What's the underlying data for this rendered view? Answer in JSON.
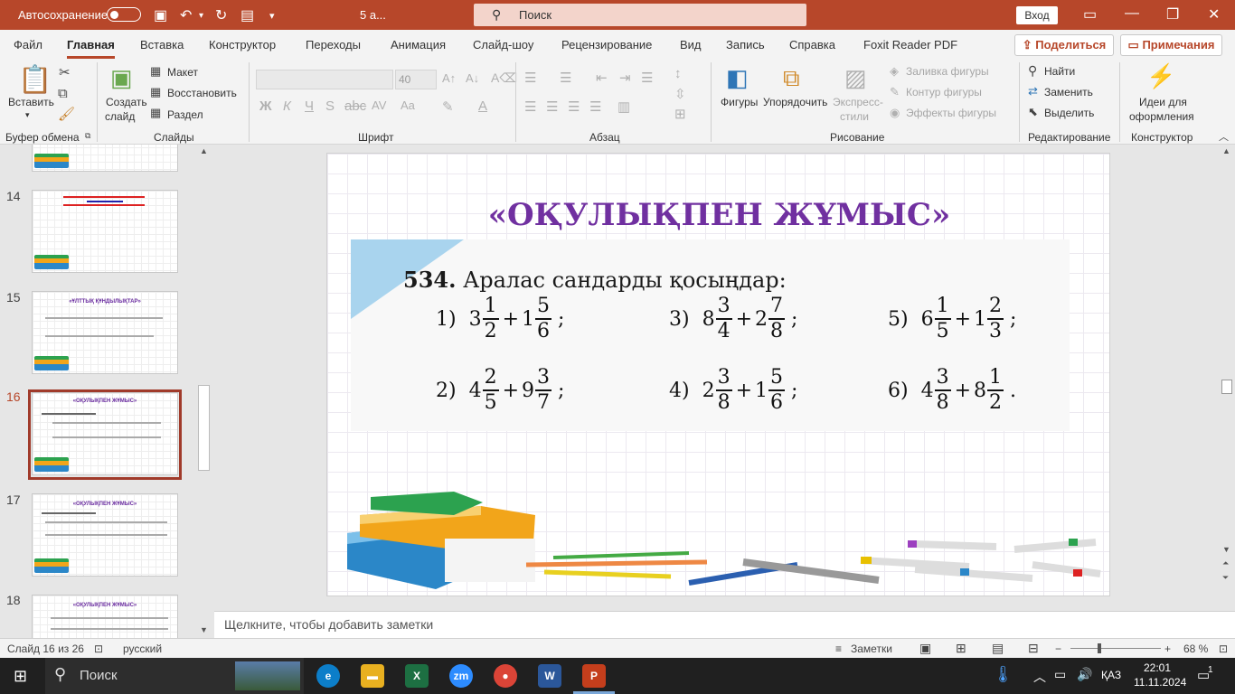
{
  "titlebar": {
    "autosave_label": "Автосохранение",
    "filename": "5 а...",
    "search_placeholder": "Поиск",
    "signin_label": "Вход"
  },
  "menu": {
    "items": [
      "Файл",
      "Главная",
      "Вставка",
      "Конструктор",
      "Переходы",
      "Анимация",
      "Слайд-шоу",
      "Рецензирование",
      "Вид",
      "Запись",
      "Справка",
      "Foxit Reader PDF"
    ],
    "share_label": "Поделиться",
    "comments_label": "Примечания"
  },
  "ribbon": {
    "paste_label": "Вставить",
    "clipboard_group": "Буфер обмена",
    "new_slide_label_1": "Создать",
    "new_slide_label_2": "слайд",
    "layout_label": "Макет",
    "reset_label": "Восстановить",
    "section_label": "Раздел",
    "slides_group": "Слайды",
    "font_size": "40",
    "font_group": "Шрифт",
    "paragraph_group": "Абзац",
    "shapes_label": "Фигуры",
    "arrange_label": "Упорядочить",
    "quick_styles_1": "Экспресс-",
    "quick_styles_2": "стили",
    "fill_label": "Заливка фигуры",
    "outline_label": "Контур фигуры",
    "effects_label": "Эффекты фигуры",
    "drawing_group": "Рисование",
    "find_label": "Найти",
    "replace_label": "Заменить",
    "select_label": "Выделить",
    "editing_group": "Редактирование",
    "designer_label_1": "Идеи для",
    "designer_label_2": "оформления",
    "designer_group": "Конструктор"
  },
  "slides_panel": {
    "thumbs": [
      {
        "num": "14",
        "title": ""
      },
      {
        "num": "15",
        "title": "«ҰЛТТЫҚ ҚҰНДЫЛЫҚТАР»"
      },
      {
        "num": "16",
        "title": "«ОҚУЛЫҚПЕН ЖҰМЫС»"
      },
      {
        "num": "17",
        "title": "«ОҚУЛЫҚПЕН ЖҰМЫС»"
      },
      {
        "num": "18",
        "title": "«ОҚУЛЫҚПЕН ЖҰМЫС»"
      }
    ]
  },
  "slide": {
    "title": "«ОҚУЛЫҚПЕН ЖҰМЫС»",
    "task_number": "534.",
    "task_text": "Аралас сандарды қосыңдар:",
    "problems": [
      {
        "label": "1)",
        "w1": "3",
        "n1": "1",
        "d1": "2",
        "op": "+",
        "w2": "1",
        "n2": "5",
        "d2": "6",
        "end": ";"
      },
      {
        "label": "3)",
        "w1": "8",
        "n1": "3",
        "d1": "4",
        "op": "+",
        "w2": "2",
        "n2": "7",
        "d2": "8",
        "end": ";"
      },
      {
        "label": "5)",
        "w1": "6",
        "n1": "1",
        "d1": "5",
        "op": "+",
        "w2": "1",
        "n2": "2",
        "d2": "3",
        "end": ";"
      },
      {
        "label": "2)",
        "w1": "4",
        "n1": "2",
        "d1": "5",
        "op": "+",
        "w2": "9",
        "n2": "3",
        "d2": "7",
        "end": ";"
      },
      {
        "label": "4)",
        "w1": "2",
        "n1": "3",
        "d1": "8",
        "op": "+",
        "w2": "1",
        "n2": "5",
        "d2": "6",
        "end": ";"
      },
      {
        "label": "6)",
        "w1": "4",
        "n1": "3",
        "d1": "8",
        "op": "+",
        "w2": "8",
        "n2": "1",
        "d2": "2",
        "end": "."
      }
    ]
  },
  "notes_placeholder": "Щелкните, чтобы добавить заметки",
  "status": {
    "slide_counter": "Слайд 16 из 26",
    "language": "русский",
    "notes_label": "Заметки",
    "zoom": "68 %"
  },
  "taskbar": {
    "search_label": "Поиск",
    "lang": "ҚАЗ",
    "time": "22:01",
    "date": "11.11.2024",
    "notif_count": "1"
  },
  "colors": {
    "accent": "#b7472a",
    "title_purple": "#7030a0"
  }
}
